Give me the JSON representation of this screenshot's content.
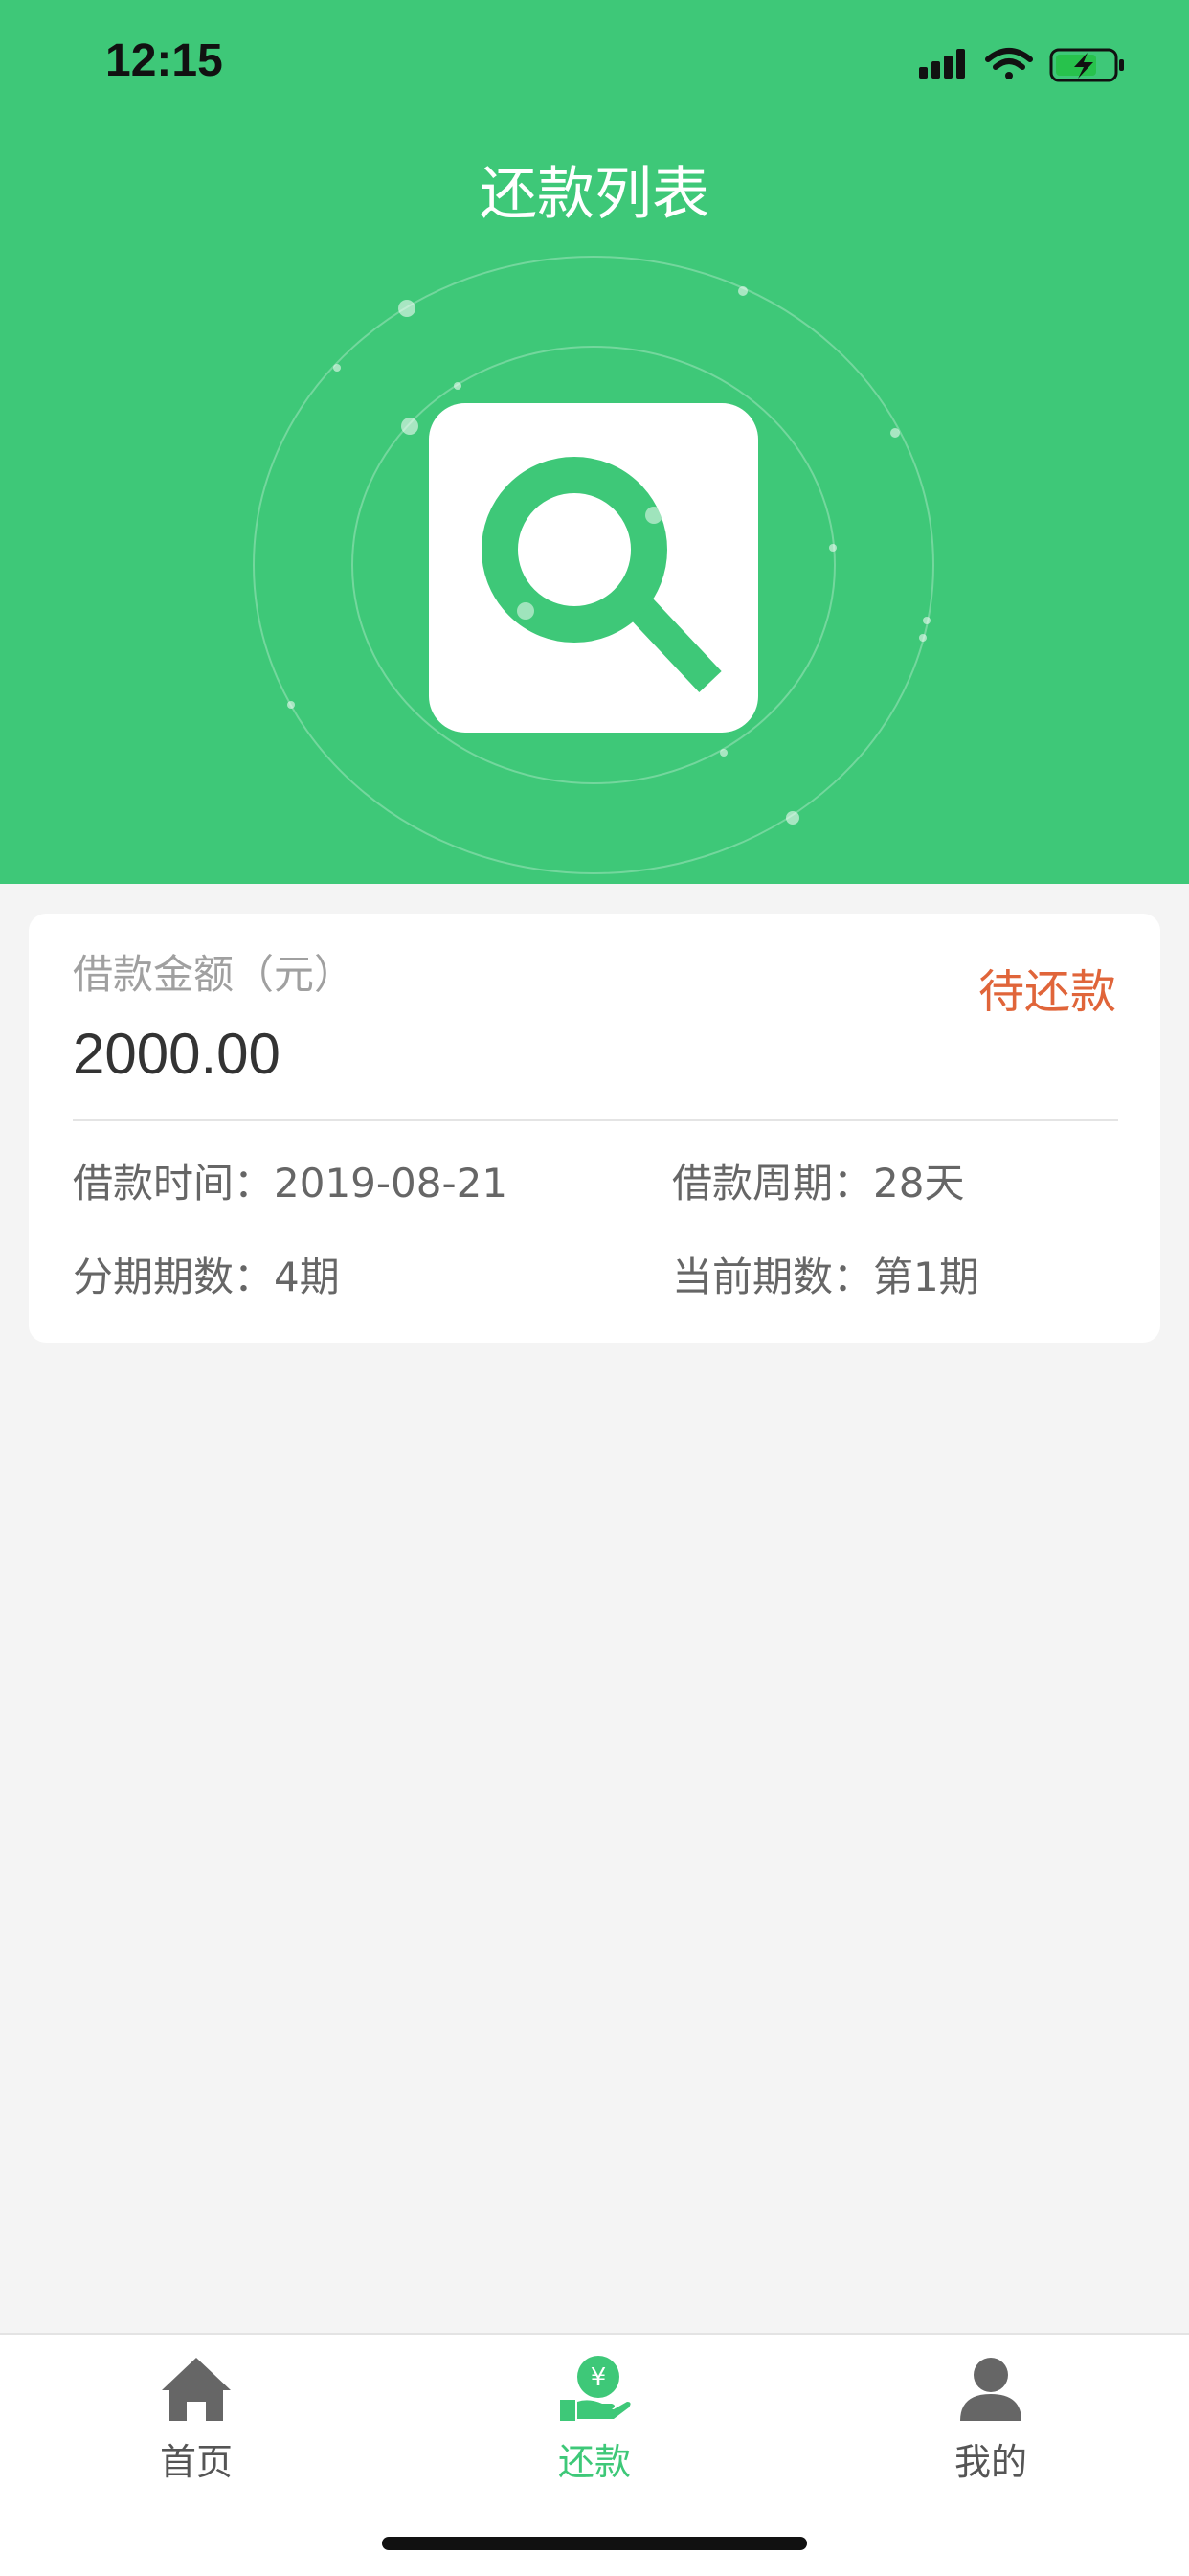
{
  "status_bar": {
    "time": "12:15",
    "icons": [
      "signal-icon",
      "wifi-icon",
      "battery-charging-icon"
    ]
  },
  "header": {
    "title": "还款列表",
    "icon": "search-icon",
    "background_color": "#3ec878"
  },
  "loan_card": {
    "amount_label": "借款金额（元）",
    "amount": "2000.00",
    "status": "待还款",
    "status_color": "#e0653a",
    "fields": [
      {
        "label": "借款时间：",
        "value": "2019-08-21"
      },
      {
        "label": "借款周期：",
        "value": "28天"
      },
      {
        "label": "分期期数：",
        "value": "4期"
      },
      {
        "label": "当前期数：",
        "value": "第1期"
      }
    ]
  },
  "tabbar": {
    "active_color": "#3ec878",
    "tabs": [
      {
        "label": "首页",
        "icon": "home-icon",
        "active": false
      },
      {
        "label": "还款",
        "icon": "repay-hand-yuan-icon",
        "active": true
      },
      {
        "label": "我的",
        "icon": "user-icon",
        "active": false
      }
    ]
  }
}
